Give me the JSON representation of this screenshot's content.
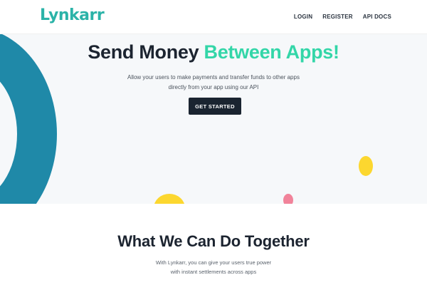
{
  "brand": {
    "name": "Lynkarr",
    "color": "#2bb3a8"
  },
  "nav": {
    "items": [
      {
        "label": "LOGIN"
      },
      {
        "label": "REGISTER"
      },
      {
        "label": "API DOCS"
      }
    ]
  },
  "hero": {
    "title_main": "Send Money",
    "title_accent": "Between Apps!",
    "subtitle_line1": "Allow your users to make payments and transfer funds to other apps",
    "subtitle_line2": "directly from your app using our API",
    "cta_label": "GET STARTED",
    "colors": {
      "accent": "#33d6a8",
      "ring": "#1f89a8",
      "yellow": "#fcd72f",
      "pink": "#f1839a",
      "button": "#1a2430"
    }
  },
  "features": {
    "title": "What We Can Do Together",
    "subtitle_line1": "With Lynkarr, you can give your users true power",
    "subtitle_line2": "with instant settlements across apps"
  }
}
